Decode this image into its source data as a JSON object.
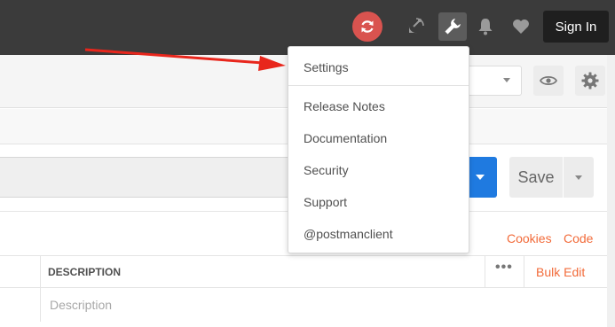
{
  "topbar": {
    "sync_icon": "sync-icon",
    "satellite_icon": "satellite-icon",
    "wrench_icon": "wrench-icon",
    "bell_icon": "bell-icon",
    "heart_icon": "heart-icon",
    "signin_label": "Sign In"
  },
  "env": {
    "eye_icon": "eye-icon",
    "gear_icon": "gear-icon"
  },
  "request": {
    "save_label": "Save"
  },
  "subtabs": {
    "cookies_label": "Cookies",
    "code_label": "Code"
  },
  "params_table": {
    "description_header": "DESCRIPTION",
    "more_label": "•••",
    "bulk_edit_label": "Bulk Edit",
    "description_placeholder": "Description"
  },
  "settings_menu": {
    "items": [
      {
        "label": "Settings"
      },
      {
        "label": "Release Notes"
      },
      {
        "label": "Documentation"
      },
      {
        "label": "Security"
      },
      {
        "label": "Support"
      },
      {
        "label": "@postmanclient"
      }
    ]
  },
  "colors": {
    "accent_orange": "#f26b3a",
    "send_blue": "#1f7ae0",
    "sync_red": "#d9534f",
    "annotation_arrow": "#e8261c"
  }
}
